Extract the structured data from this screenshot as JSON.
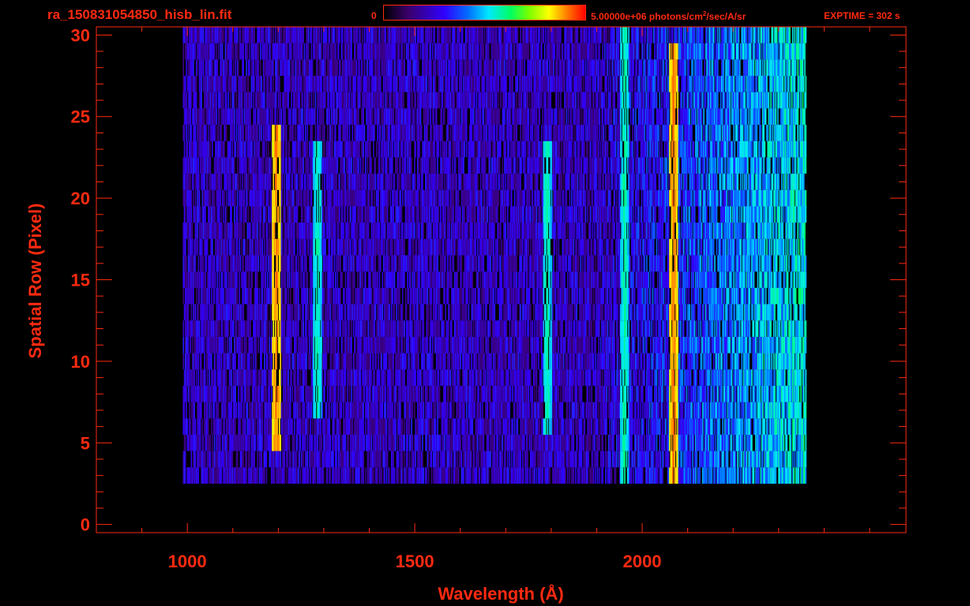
{
  "header": {
    "file_title": "ra_150831054850_hisb_lin.fit",
    "colorbar_min": "0",
    "colorbar_max_prefix": "5.00000e+06 photons/cm",
    "colorbar_max_sup": "2",
    "colorbar_max_suffix": "/sec/A/sr",
    "exptime": "EXPTIME = 302 s"
  },
  "chart_data": {
    "type": "heatmap",
    "xlabel": "Wavelength (Å)",
    "ylabel": "Spatial Row (Pixel)",
    "xlim": [
      800,
      2580
    ],
    "ylim": [
      -0.5,
      30.5
    ],
    "x_tick_labels": [
      "1000",
      "1500",
      "2000"
    ],
    "x_tick_values": [
      1000,
      1500,
      2000
    ],
    "y_tick_labels": [
      "0",
      "5",
      "10",
      "15",
      "20",
      "25",
      "30"
    ],
    "y_tick_values": [
      0,
      5,
      10,
      15,
      20,
      25,
      30
    ],
    "colorscale": {
      "min": 0,
      "max": 5000000,
      "units": "photons/cm²/sec/A/sr",
      "name": "rainbow"
    },
    "data_extent": {
      "x": [
        990,
        2360
      ],
      "y": [
        3,
        30
      ]
    },
    "emission_features": [
      {
        "x": 1195,
        "y": [
          5,
          24
        ],
        "level": "high"
      },
      {
        "x": 1285,
        "y": [
          7,
          23
        ],
        "level": "medium"
      },
      {
        "x": 1790,
        "y": [
          6,
          23
        ],
        "level": "medium"
      },
      {
        "x": 1960,
        "y": [
          3,
          30
        ],
        "level": "medium"
      },
      {
        "x": 2068,
        "y": [
          2,
          29
        ],
        "level": "high"
      }
    ],
    "grid": false,
    "colors": {
      "axis": "#ff2a10",
      "background": "#000000"
    }
  }
}
